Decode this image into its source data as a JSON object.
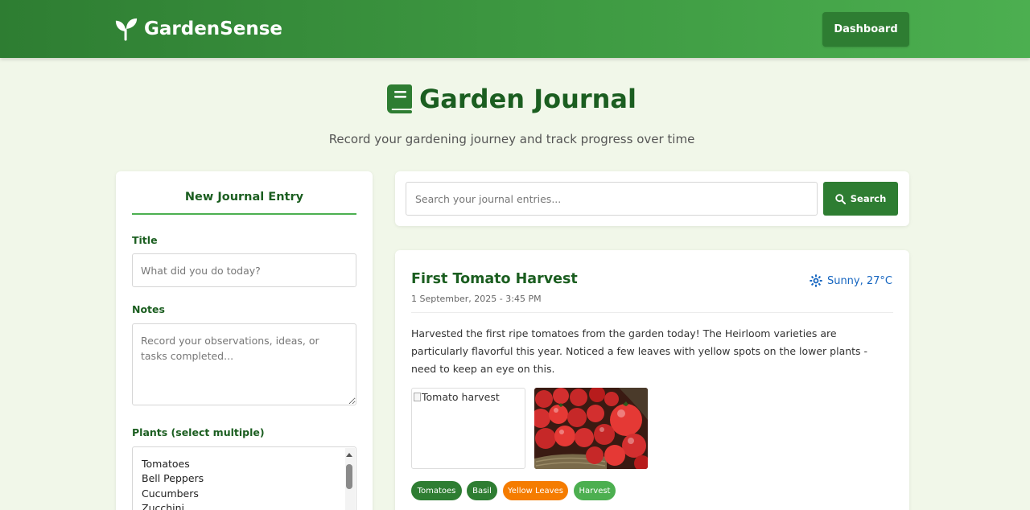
{
  "app": {
    "name": "GardenSense"
  },
  "nav": {
    "dashboard_label": "Dashboard"
  },
  "page": {
    "title": "Garden Journal",
    "subtitle": "Record your gardening journey and track progress over time"
  },
  "form": {
    "heading": "New Journal Entry",
    "title_label": "Title",
    "title_placeholder": "What did you do today?",
    "notes_label": "Notes",
    "notes_placeholder": "Record your observations, ideas, or tasks completed...",
    "plants_label": "Plants (select multiple)",
    "plant_options": [
      "Tomatoes",
      "Bell Peppers",
      "Cucumbers",
      "Zucchini"
    ]
  },
  "search": {
    "placeholder": "Search your journal entries...",
    "button_label": "Search"
  },
  "entry": {
    "title": "First Tomato Harvest",
    "date": "1 September, 2025 - 3:45 PM",
    "weather": "Sunny, 27°C",
    "body": "Harvested the first ripe tomatoes from the garden today! The Heirloom varieties are particularly flavorful this year. Noticed a few leaves with yellow spots on the lower plants - need to keep an eye on this.",
    "image_alt": "Tomato harvest",
    "tags": [
      {
        "label": "Tomatoes",
        "color": "#2e7d32"
      },
      {
        "label": "Basil",
        "color": "#2e7d32"
      },
      {
        "label": "Yellow Leaves",
        "color": "#f57c00"
      },
      {
        "label": "Harvest",
        "color": "#4caf50"
      }
    ]
  },
  "icons": {
    "brand": "sprout-icon",
    "title": "book-icon",
    "search": "search-icon",
    "weather": "sun-icon"
  }
}
